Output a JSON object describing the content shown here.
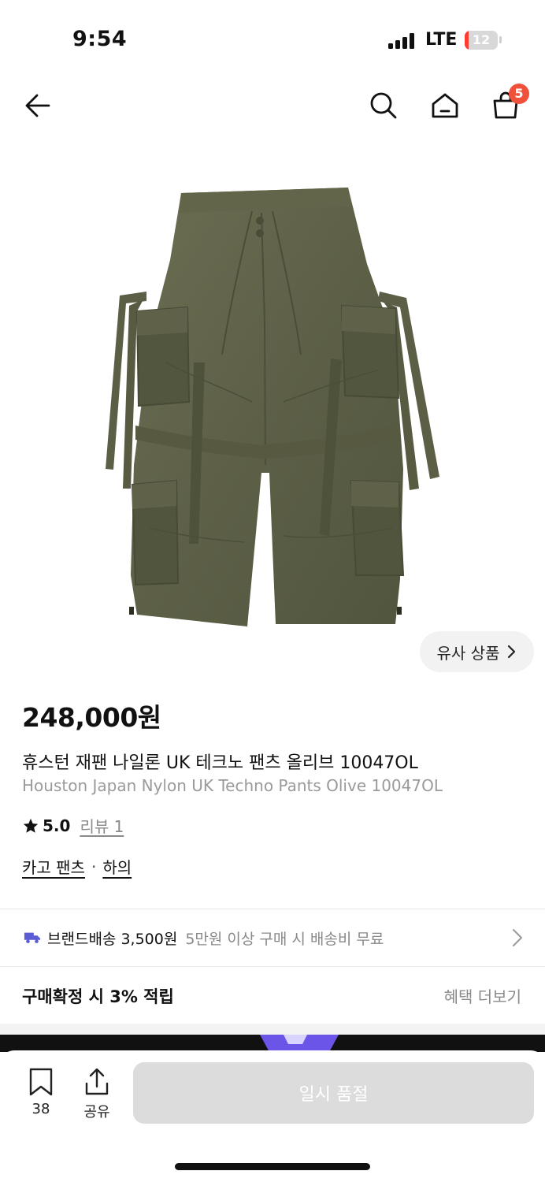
{
  "status_bar": {
    "time": "9:54",
    "network": "LTE",
    "battery": "12",
    "battery_level": 0.12,
    "battery_color": "#ff3b30"
  },
  "header": {
    "icons": [
      "back-arrow-icon",
      "search-icon",
      "home-icon",
      "cart-icon"
    ],
    "cart_count": "5",
    "badge_color": "#f0513b"
  },
  "product": {
    "image_icon": "olive-cargo-pants",
    "similar_button_label": "유사 상품",
    "price": "248,000원",
    "title_ko": "휴스턴 재팬 나일론 UK 테크노 팬츠 올리브 10047OL",
    "title_en": "Houston Japan Nylon UK Techno Pants Olive 10047OL",
    "rating": "5.0",
    "review_label": "리뷰 1",
    "category_primary": "카고 팬츠",
    "category_separator": "·",
    "category_secondary": "하의"
  },
  "shipping": {
    "label": "브랜드배송 3,500원",
    "note": "5만원 이상 구매 시 배송비 무료",
    "icon_color": "#5b5bd6"
  },
  "benefit": {
    "points_text": "구매확정 시 3% 적립",
    "more_link": "혜택 더보기"
  },
  "bottom_bar": {
    "bookmark_count": "38",
    "share_label": "공유",
    "soldout_label": "일시 품절"
  }
}
